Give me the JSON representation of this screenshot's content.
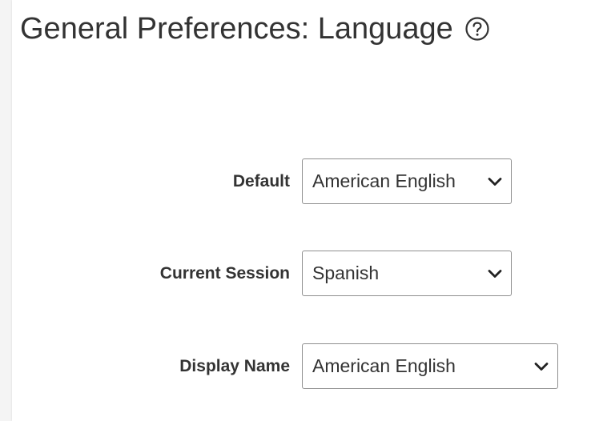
{
  "page": {
    "title": "General Preferences: Language",
    "help_icon": "question-circle-icon"
  },
  "fields": [
    {
      "label": "Default",
      "value": "American English",
      "control": "select",
      "icon": "chevron-down-icon"
    },
    {
      "label": "Current Session",
      "value": "Spanish",
      "control": "select",
      "icon": "chevron-down-icon"
    },
    {
      "label": "Display Name",
      "value": "American English",
      "control": "select",
      "icon": "chevron-down-icon"
    }
  ],
  "colors": {
    "text": "#333333",
    "border": "#8f8f8f",
    "background": "#ffffff",
    "page_gutter": "#f4f4f4"
  }
}
